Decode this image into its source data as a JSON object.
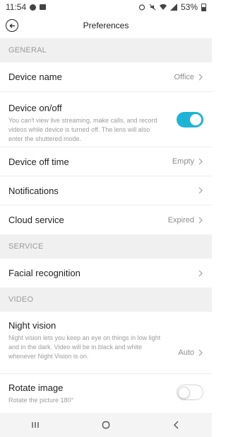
{
  "status_bar": {
    "time": "11:54",
    "battery": "53%"
  },
  "header": {
    "title": "Preferences"
  },
  "sections": {
    "general": "GENERAL",
    "service": "SERVICE",
    "video": "VIDEO"
  },
  "general": {
    "device_name": {
      "label": "Device name",
      "value": "Office"
    },
    "device_onoff": {
      "label": "Device on/off",
      "description": "You can't view live streaming, make calls, and record videos while device is turned off. The lens will also enter the shuttered mode.",
      "enabled": true
    },
    "device_off_time": {
      "label": "Device off time",
      "value": "Empty"
    },
    "notifications": {
      "label": "Notifications"
    },
    "cloud_service": {
      "label": "Cloud service",
      "value": "Expired"
    }
  },
  "service": {
    "facial_recognition": {
      "label": "Facial recognition"
    }
  },
  "video": {
    "night_vision": {
      "label": "Night vision",
      "description": "Night vision lets you keep an eye on things in low light and in the dark. Video will be in black and white whenever Night Vision is on.",
      "value": "Auto"
    },
    "rotate_image": {
      "label": "Rotate image",
      "description": "Rotate the picture 180°",
      "enabled": false
    }
  },
  "colors": {
    "accent": "#1fb4d6",
    "section_bg": "#f0f0f0"
  }
}
